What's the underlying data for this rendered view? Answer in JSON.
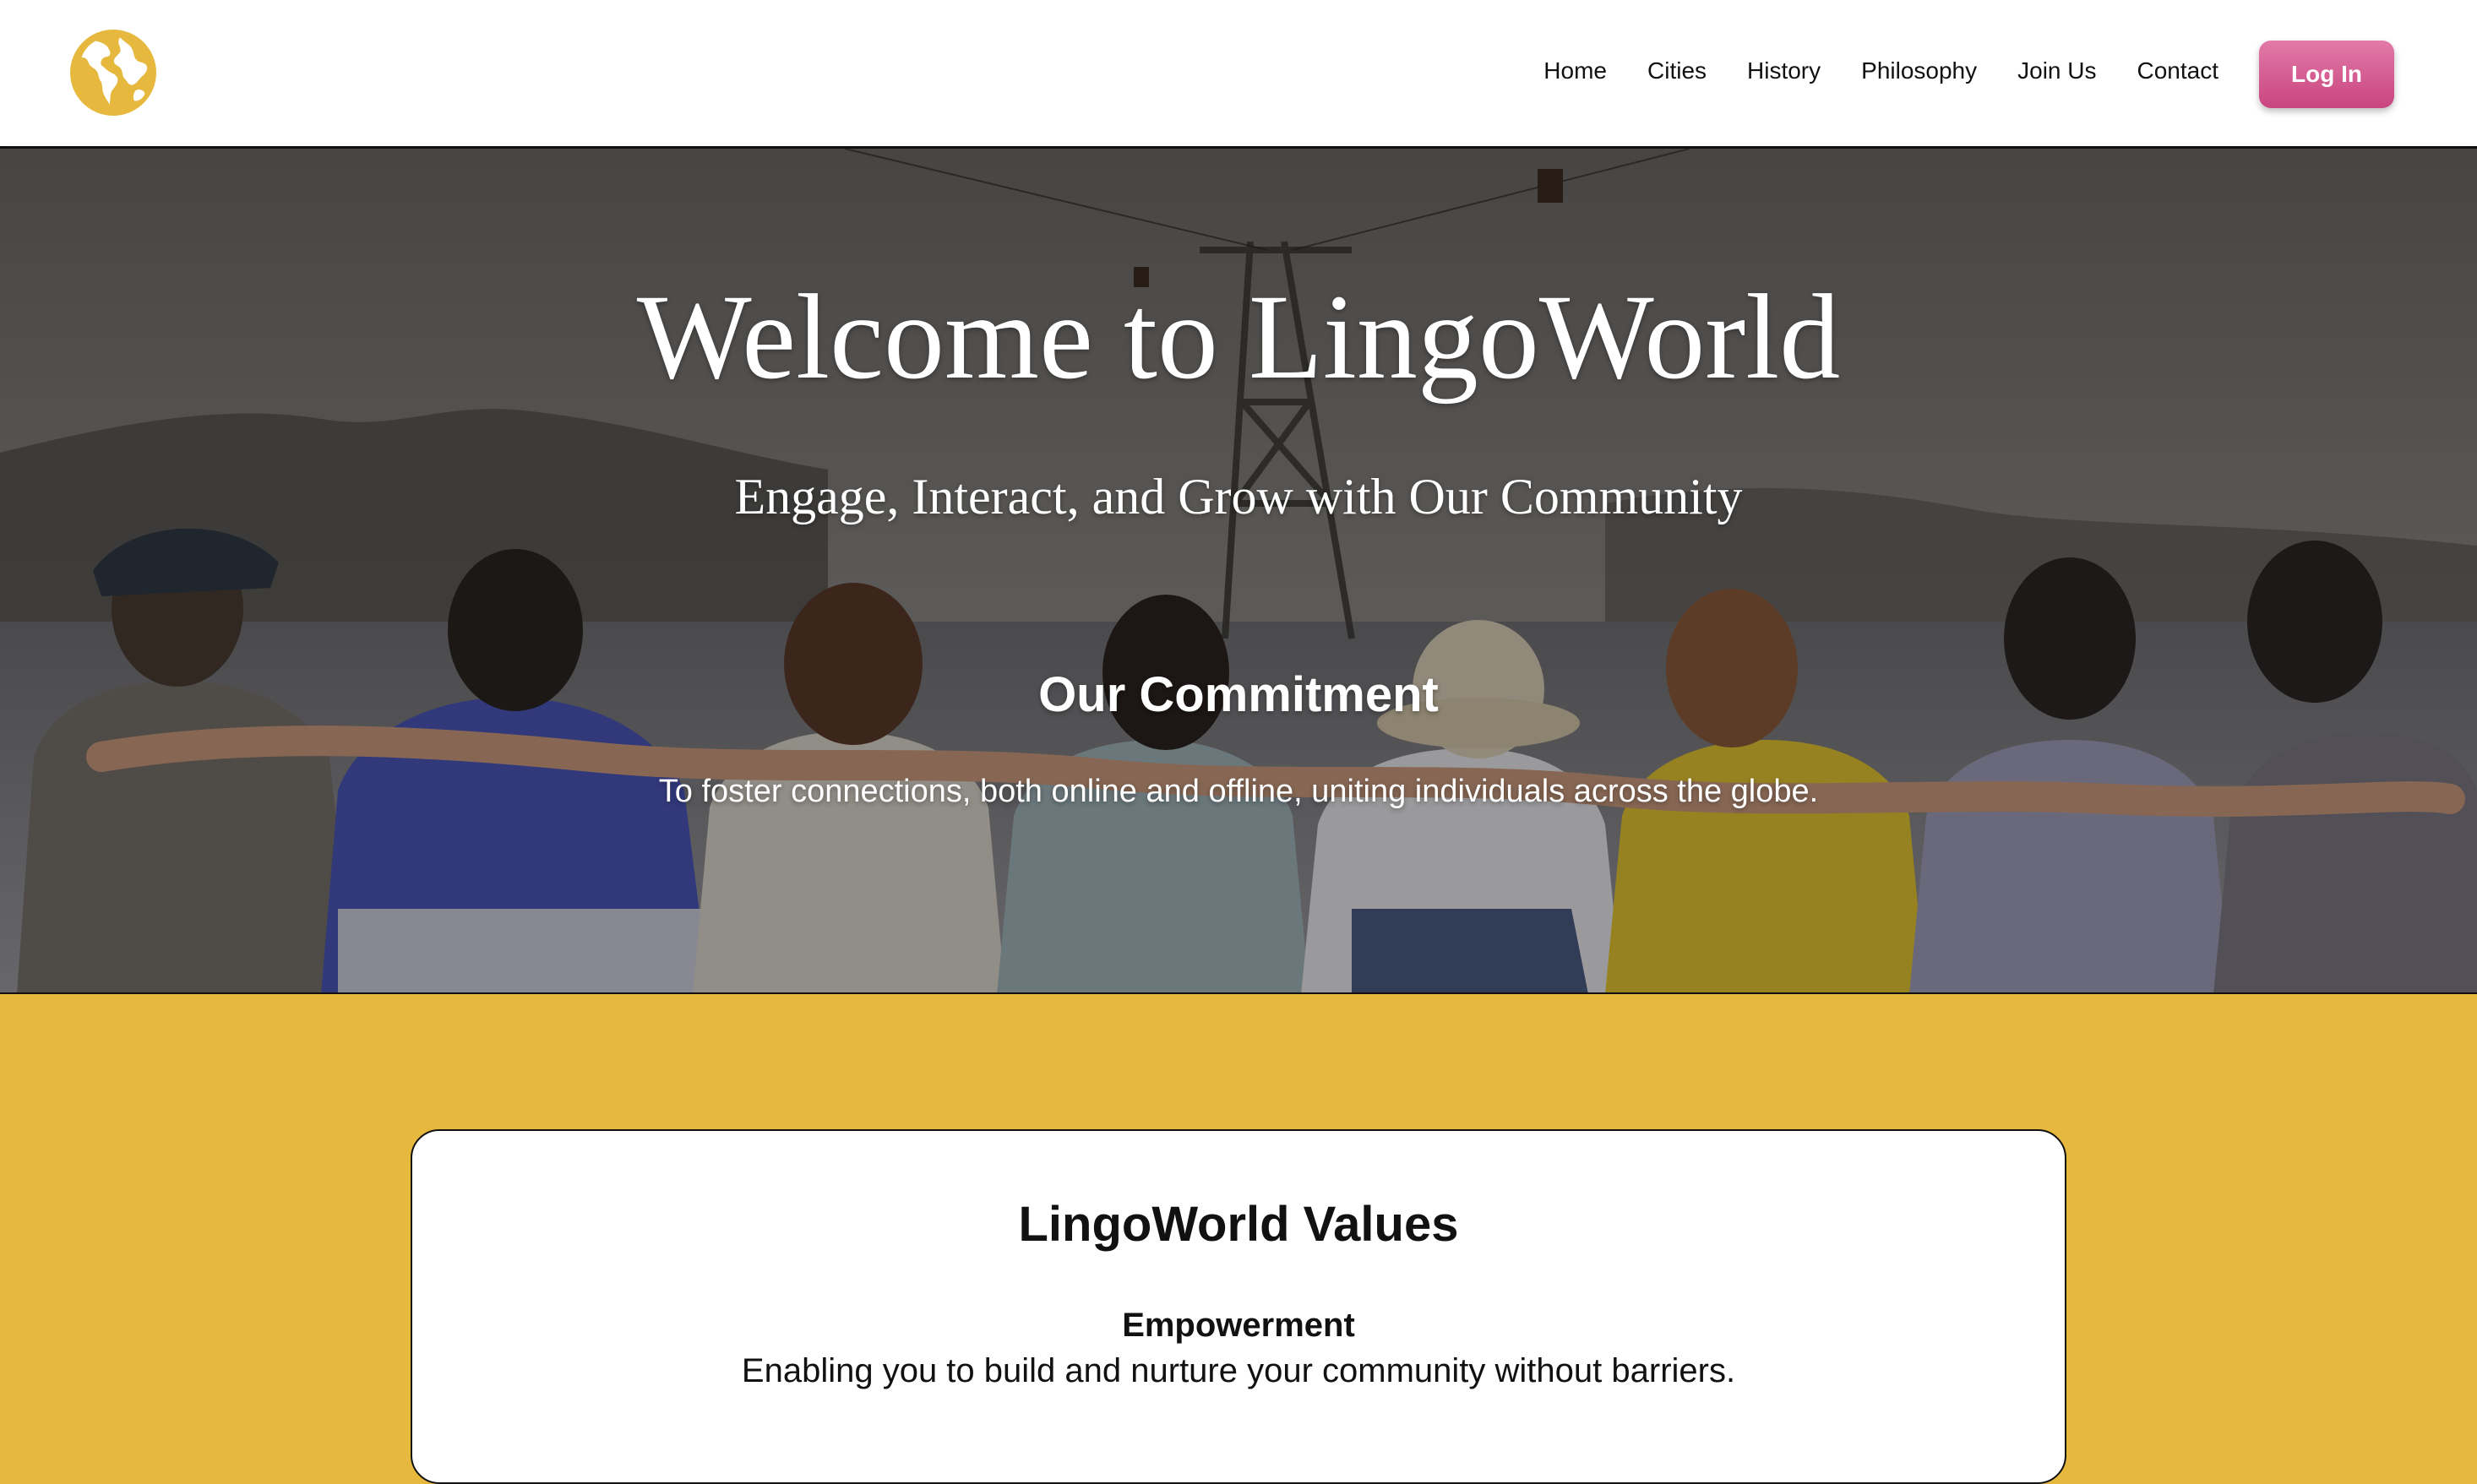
{
  "colors": {
    "accent_yellow": "#e6b83d",
    "login_pink": "#d55a93",
    "header_bg": "#ffffff",
    "text_dark": "#111111"
  },
  "header": {
    "logo_icon": "globe-icon",
    "nav": {
      "home": "Home",
      "cities": "Cities",
      "history": "History",
      "philosophy": "Philosophy",
      "join_us": "Join Us",
      "contact": "Contact"
    },
    "login_label": "Log In"
  },
  "hero": {
    "title": "Welcome to LingoWorld",
    "subtitle": "Engage, Interact, and Grow with Our Community",
    "commitment_title": "Our Commitment",
    "commitment_text": "To foster connections, both online and offline, uniting individuals across the globe."
  },
  "values": {
    "title": "LingoWorld Values",
    "items": [
      {
        "name": "Empowerment",
        "description": "Enabling you to build and nurture your community without barriers."
      }
    ]
  }
}
